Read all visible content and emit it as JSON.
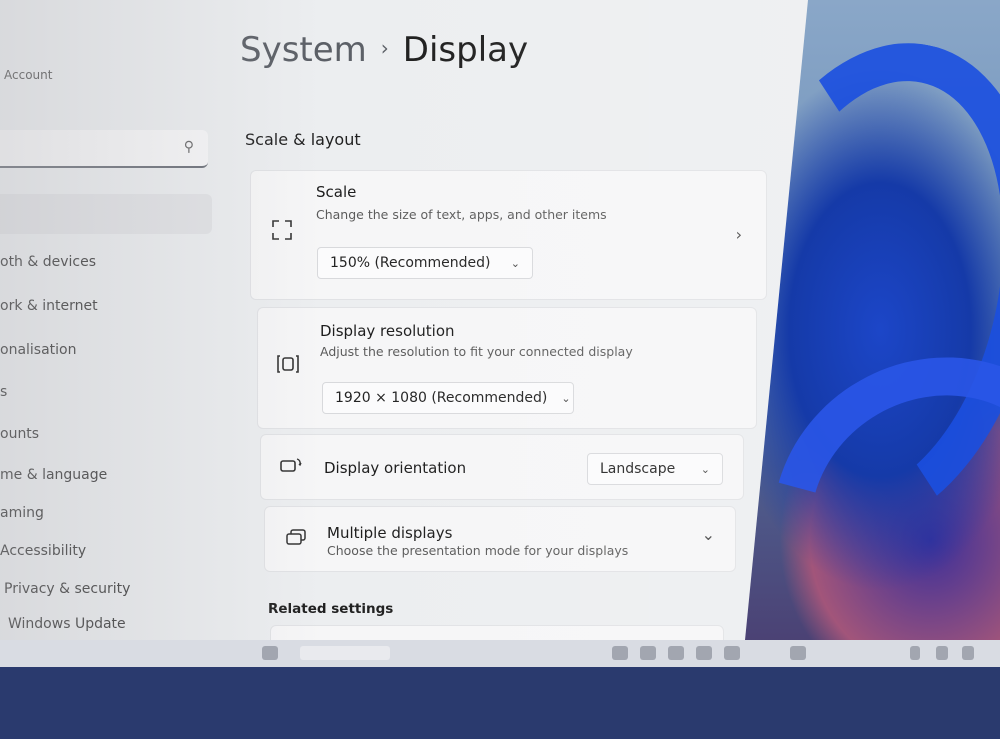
{
  "breadcrumb": {
    "parent": "System",
    "separator": "›",
    "current": "Display"
  },
  "sidebar": {
    "account": "Account",
    "search": {
      "placeholder": "",
      "icon": "search-icon"
    },
    "items": [
      {
        "label": "oth & devices"
      },
      {
        "label": "ork & internet"
      },
      {
        "label": "onalisation"
      },
      {
        "label": "s"
      },
      {
        "label": "ounts"
      },
      {
        "label": "me & language"
      },
      {
        "label": "aming"
      },
      {
        "label": "Accessibility"
      },
      {
        "label": "Privacy & security"
      },
      {
        "label": "Windows Update"
      }
    ]
  },
  "sections": {
    "scale_layout": "Scale & layout",
    "related": "Related settings"
  },
  "cards": {
    "scale": {
      "title": "Scale",
      "desc": "Change the size of text, apps, and other items",
      "value": "150% (Recommended)",
      "icon": "scale-icon",
      "nav": "›"
    },
    "resolution": {
      "title": "Display resolution",
      "desc": "Adjust the resolution to fit your connected display",
      "value": "1920 × 1080 (Recommended)",
      "icon": "resolution-icon"
    },
    "orientation": {
      "title": "Display orientation",
      "value": "Landscape",
      "icon": "orientation-icon"
    },
    "multiple": {
      "title": "Multiple displays",
      "desc": "Choose the presentation mode for your displays",
      "icon": "multiple-displays-icon",
      "expand": "⌄"
    }
  },
  "colors": {
    "accent": "#1b4fe0",
    "window_bg": "#eceef0",
    "card_bg": "#f6f6f7"
  }
}
